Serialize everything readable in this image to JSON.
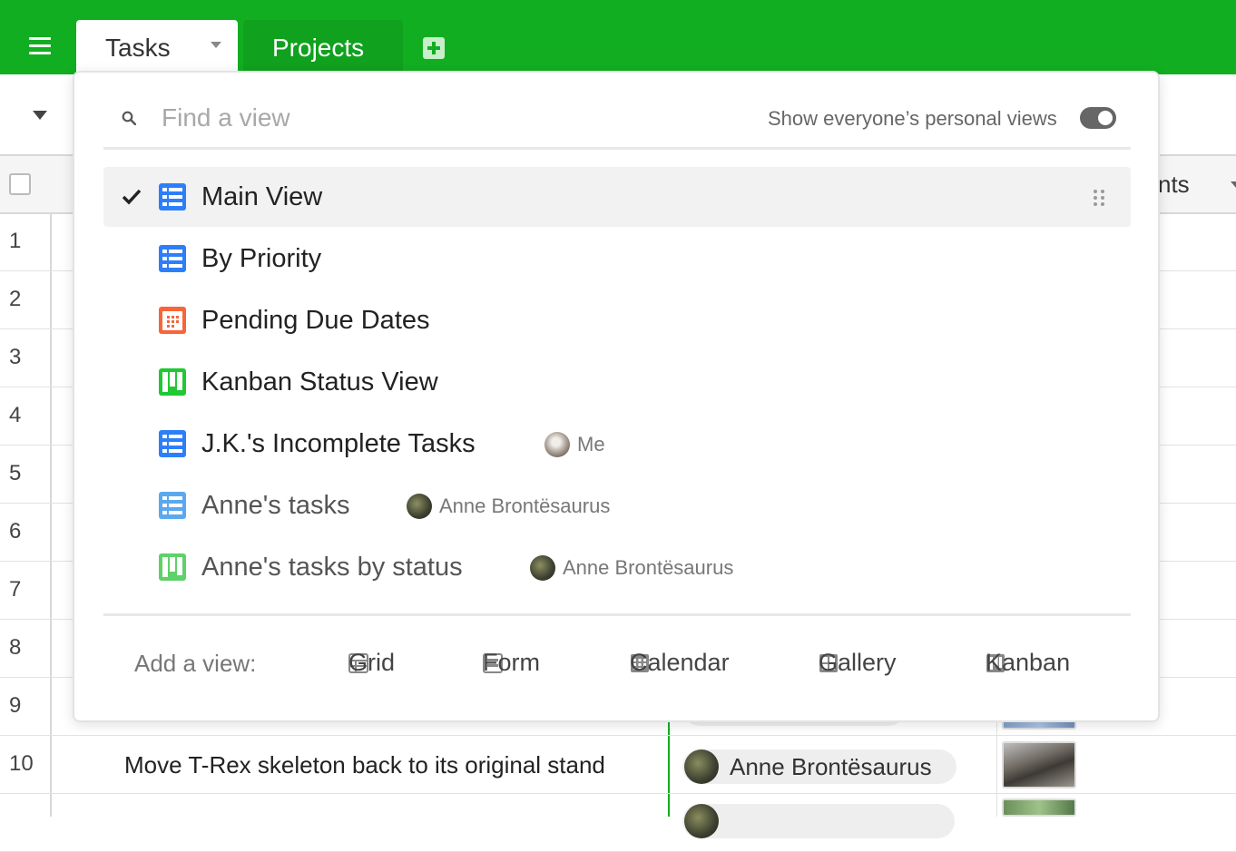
{
  "header": {
    "tabs": [
      {
        "label": "Tasks",
        "active": true
      },
      {
        "label": "Projects",
        "active": false
      }
    ],
    "brand_color": "#12ae21"
  },
  "grid": {
    "partial_header": "nts",
    "row_numbers": [
      "1",
      "2",
      "3",
      "4",
      "5",
      "6",
      "7",
      "8",
      "9",
      "10"
    ],
    "visible_row": {
      "number": "10",
      "name": "Move T-Rex skeleton back to its original stand",
      "assignee": "Anne Brontësaurus"
    }
  },
  "view_switcher": {
    "search_placeholder": "Find a view",
    "toggle_label": "Show everyone’s personal views",
    "toggle_on": true,
    "views": [
      {
        "name": "Main View",
        "type": "grid",
        "icon": "grid-view-icon",
        "color": "#2d7ff9",
        "selected": true
      },
      {
        "name": "By Priority",
        "type": "grid",
        "icon": "grid-view-icon",
        "color": "#2d7ff9"
      },
      {
        "name": "Pending Due Dates",
        "type": "calendar",
        "icon": "calendar-view-icon",
        "color": "#f7653b"
      },
      {
        "name": "Kanban Status View",
        "type": "kanban",
        "icon": "kanban-view-icon",
        "color": "#20c933"
      },
      {
        "name": "J.K.'s Incomplete Tasks",
        "type": "grid",
        "icon": "grid-view-icon",
        "color": "#2d7ff9",
        "owner": "Me"
      },
      {
        "name": "Anne's tasks",
        "type": "grid",
        "icon": "grid-view-icon",
        "color": "#5ba8f0",
        "owner": "Anne Brontësaurus"
      },
      {
        "name": "Anne's tasks by status",
        "type": "kanban",
        "icon": "kanban-view-icon",
        "color": "#5cd268",
        "owner": "Anne Brontësaurus"
      }
    ],
    "add_view": {
      "label": "Add a view:",
      "options": [
        {
          "label": "Grid",
          "icon": "grid-icon"
        },
        {
          "label": "Form",
          "icon": "form-icon"
        },
        {
          "label": "Calendar",
          "icon": "calendar-icon"
        },
        {
          "label": "Gallery",
          "icon": "gallery-icon"
        },
        {
          "label": "Kanban",
          "icon": "kanban-icon"
        }
      ]
    }
  }
}
